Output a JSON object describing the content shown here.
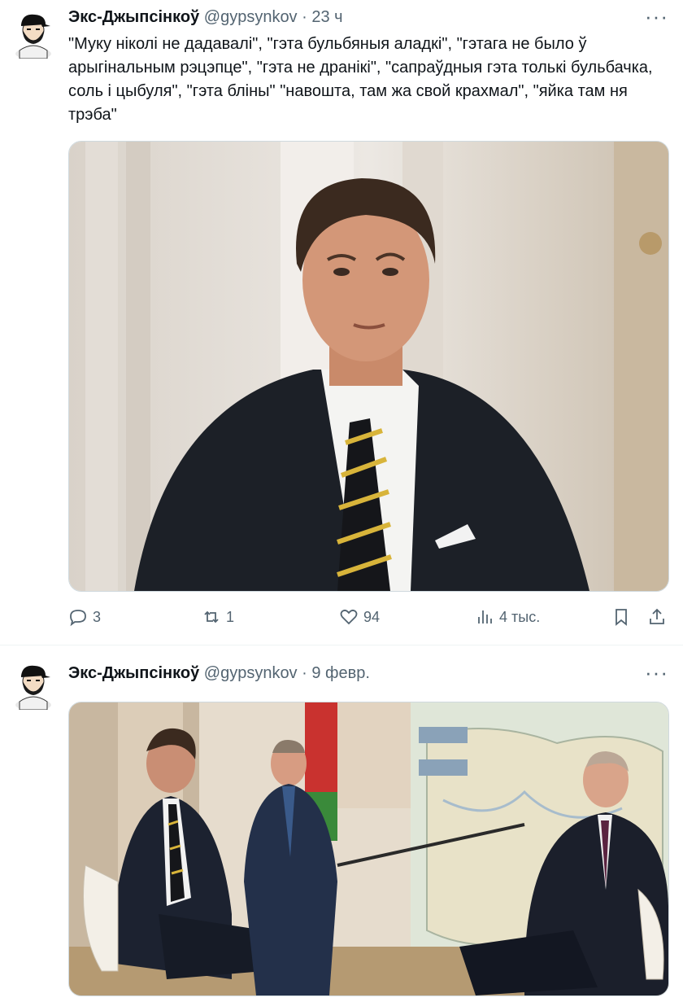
{
  "tweets": [
    {
      "author": {
        "name": "Экс-Джыпсінкоў",
        "handle": "@gypsynkov",
        "avatar_icon": "avatar-bearded-man-cap"
      },
      "separator": "·",
      "time": "23 ч",
      "more_label": "···",
      "text": "\"Муку ніколі не дадавалі\", \"гэта бульбяныя аладкі\", \"гэтага не было ў арыгінальным рэцэпце\", \"гэта не дранікі\", \"сапраўдныя гэта толькі бульбачка, соль і цыбуля\", \"гэта бліны\" \"навошта, там жа свой крахмал\", \"яйка там ня трэба\"",
      "media_icon": "photo-man-in-suit-striped-tie",
      "actions": {
        "replies": "3",
        "reposts": "1",
        "likes": "94",
        "views": "4 тыс."
      }
    },
    {
      "author": {
        "name": "Экс-Джыпсінкоў",
        "handle": "@gypsynkov",
        "avatar_icon": "avatar-bearded-man-cap"
      },
      "separator": "·",
      "time": "9 февр.",
      "more_label": "···",
      "media_icon": "photo-three-men-map-room"
    }
  ],
  "colors": {
    "text_primary": "#0f1419",
    "text_secondary": "#536471",
    "border": "#cfd9de",
    "divider": "#eff3f4"
  }
}
